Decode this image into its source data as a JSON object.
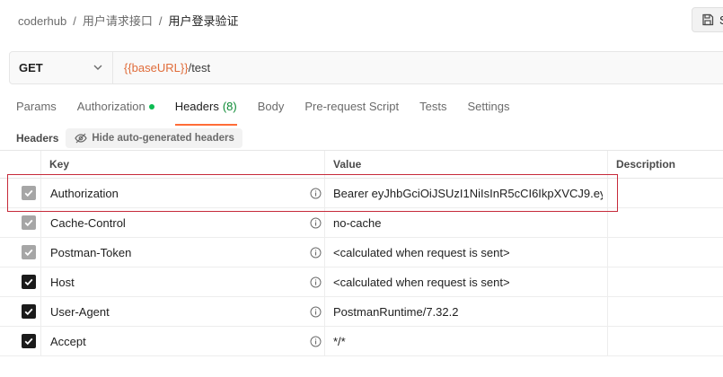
{
  "breadcrumb": {
    "root": "coderhub",
    "folder": "用户请求接口",
    "current": "用户登录验证",
    "separator": "/"
  },
  "toolbar": {
    "save_label": "S"
  },
  "request": {
    "method": "GET",
    "url_variable": "{{baseURL}}",
    "url_path": "/test"
  },
  "tabs": [
    {
      "label": "Params"
    },
    {
      "label": "Authorization"
    },
    {
      "label": "Headers",
      "count": "(8)"
    },
    {
      "label": "Body"
    },
    {
      "label": "Pre-request Script"
    },
    {
      "label": "Tests"
    },
    {
      "label": "Settings"
    }
  ],
  "headers_section": {
    "title": "Headers",
    "hide_label": "Hide auto-generated headers"
  },
  "table": {
    "columns": {
      "key": "Key",
      "value": "Value",
      "description": "Description"
    },
    "rows": [
      {
        "key": "Authorization",
        "value": "Bearer eyJhbGciOiJSUzI1NiIsInR5cCI6IkpXVCJ9.ey...",
        "check": "locked"
      },
      {
        "key": "Cache-Control",
        "value": "no-cache",
        "check": "locked"
      },
      {
        "key": "Postman-Token",
        "value": "<calculated when request is sent>",
        "check": "locked"
      },
      {
        "key": "Host",
        "value": "<calculated when request is sent>",
        "check": "on"
      },
      {
        "key": "User-Agent",
        "value": "PostmanRuntime/7.32.2",
        "check": "on"
      },
      {
        "key": "Accept",
        "value": "*/*",
        "check": "on"
      }
    ]
  },
  "colors": {
    "accent": "#ff6c37",
    "variable": "#e06c3a",
    "highlight": "#c62a3a",
    "auth_dot": "#0cbb52"
  }
}
